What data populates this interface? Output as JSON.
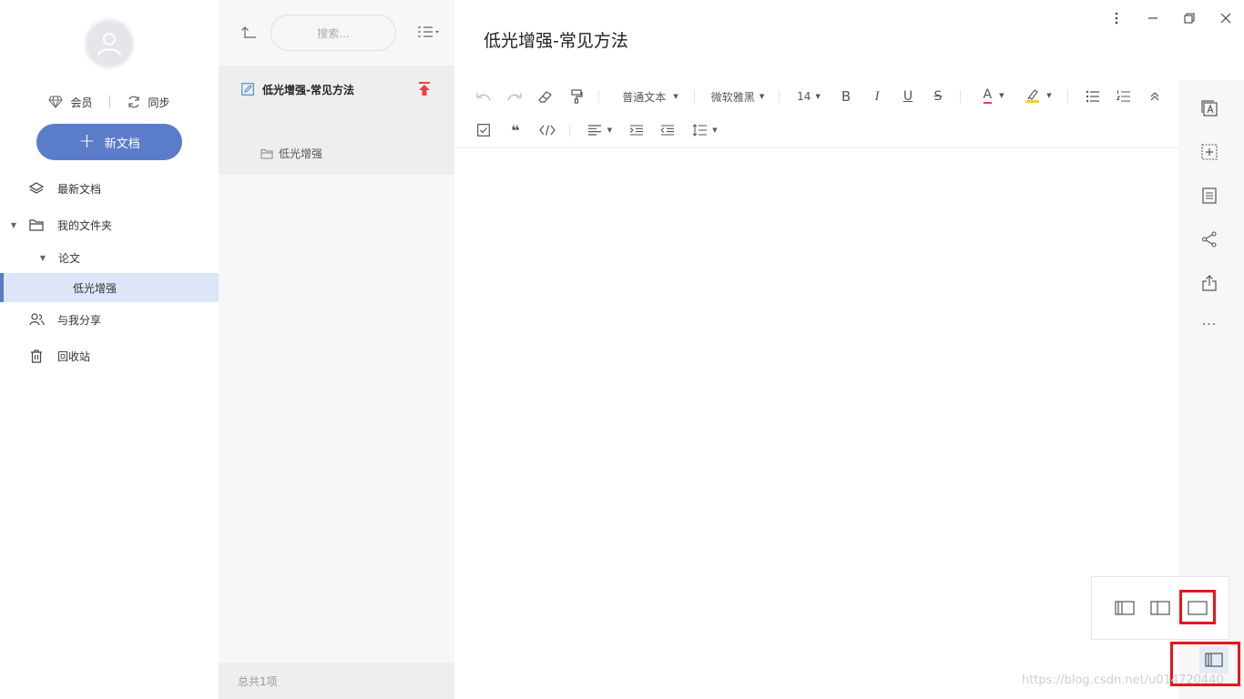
{
  "sidebar": {
    "member_label": "会员",
    "sync_label": "同步",
    "new_doc_label": "新文档",
    "nav": {
      "recent": "最新文档",
      "my_folders": "我的文件夹",
      "paper": "论文",
      "low_light": "低光增强",
      "shared": "与我分享",
      "trash": "回收站"
    }
  },
  "list": {
    "search_placeholder": "搜索...",
    "item_title": "低光增强-常见方法",
    "item_folder": "低光增强",
    "footer": "总共1项"
  },
  "editor": {
    "title": "低光增强-常见方法",
    "toolbar": {
      "paragraph_style": "普通文本",
      "font_family": "微软雅黑",
      "font_size": "14",
      "bold": "B",
      "italic": "I",
      "underline": "U",
      "strike": "S",
      "font_color": "A"
    },
    "more": "···"
  },
  "watermark": "https://blog.csdn.net/u014720440"
}
